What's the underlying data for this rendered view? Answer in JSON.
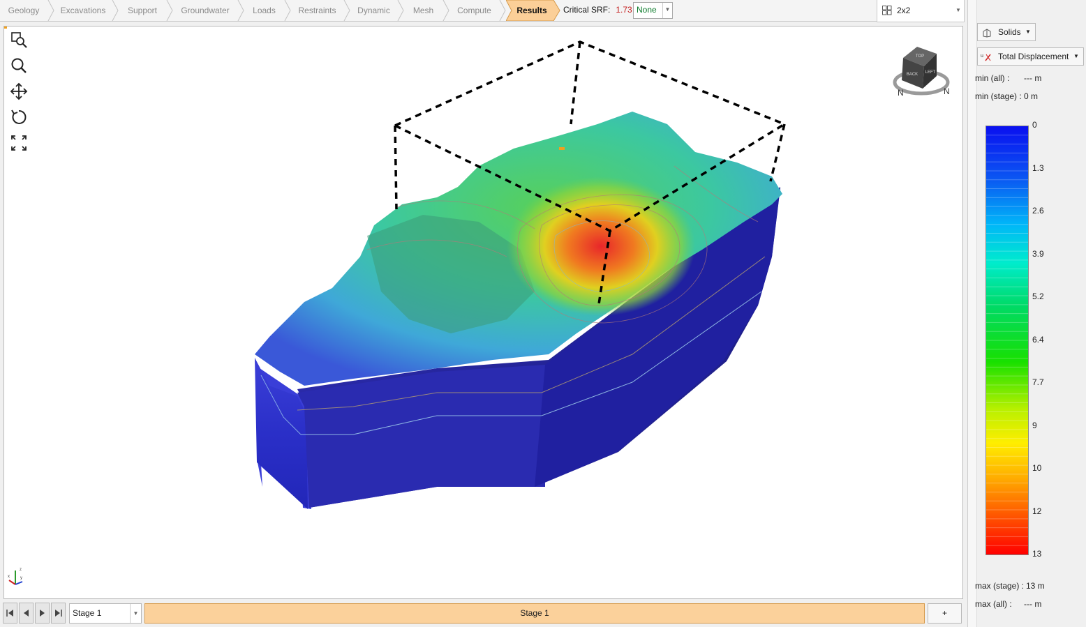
{
  "workflow": {
    "steps": [
      "Geology",
      "Excavations",
      "Support",
      "Groundwater",
      "Loads",
      "Restraints",
      "Dynamic",
      "Mesh",
      "Compute",
      "Results"
    ],
    "active_step": "Results",
    "critical_srf_label": "Critical SRF:",
    "critical_srf_value": "1.73",
    "srf_dropdown_value": "None",
    "layout_value": "2x2"
  },
  "toolbar": {
    "tools": [
      "zoom-window-icon",
      "zoom-icon",
      "pan-icon",
      "rotate-icon",
      "zoom-extents-icon"
    ]
  },
  "view_cube": {
    "faces": [
      "TOP",
      "BACK",
      "LEFT"
    ],
    "compass": [
      "N",
      "N"
    ]
  },
  "axis_triad": {
    "labels": [
      "x",
      "y",
      "z"
    ]
  },
  "bottom_bar": {
    "stage_select_value": "Stage 1",
    "stage_tab_label": "Stage 1",
    "add_stage_label": "+"
  },
  "panel": {
    "solids_label": "Solids",
    "result_type_label": "Total Displacement",
    "min_all_label": "min (all) :",
    "min_all_value": "--- m",
    "min_stage_label": "min (stage) :",
    "min_stage_value": "0 m",
    "max_stage_label": "max (stage) :",
    "max_stage_value": "13 m",
    "max_all_label": "max (all) :",
    "max_all_value": "--- m",
    "legend_ticks": [
      "0",
      "1.3",
      "2.6",
      "3.9",
      "5.2",
      "6.4",
      "7.7",
      "9",
      "10",
      "12",
      "13"
    ],
    "legend_colors": [
      "#0a10f0",
      "#00b7f8",
      "#00da66",
      "#18e000",
      "#ffee00",
      "#ff5500",
      "#ff0000"
    ]
  }
}
